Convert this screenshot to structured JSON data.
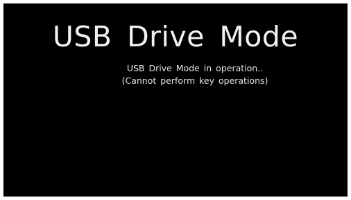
{
  "screen": {
    "title": "USB Drive Mode",
    "message_line_1": "USB Drive Mode in operation..",
    "message_line_2": "(Cannot perform key operations)"
  },
  "colors": {
    "background": "#000000",
    "text": "#f2f2f2",
    "border": "#ffffff"
  }
}
